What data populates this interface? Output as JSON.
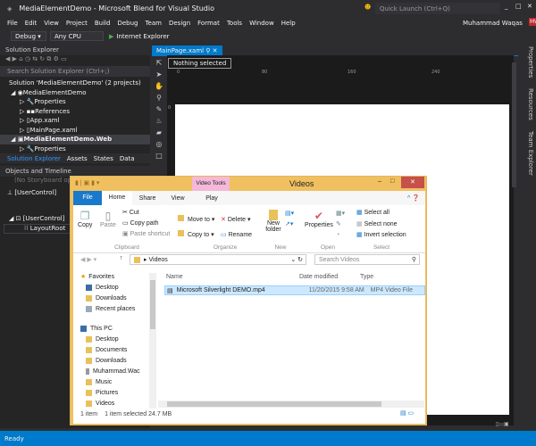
{
  "window": {
    "title": "MediaElementDemo - Microsoft Blend for Visual Studio",
    "quick_launch": "Quick Launch (Ctrl+Q)",
    "user": "Muhammad Waqas",
    "user_initials": "MW"
  },
  "menu": [
    "File",
    "Edit",
    "View",
    "Project",
    "Build",
    "Debug",
    "Team",
    "Design",
    "Format",
    "Tools",
    "Window",
    "Help"
  ],
  "toolbar": {
    "config": "Debug",
    "platform": "Any CPU",
    "run": "Internet Explorer"
  },
  "solution_explorer": {
    "title": "Solution Explorer",
    "search_placeholder": "Search Solution Explorer (Ctrl+;)",
    "items": [
      "Solution 'MediaElementDemo' (2 projects)",
      "MediaElementDemo",
      "Properties",
      "References",
      "App.xaml",
      "MainPage.xaml",
      "MediaElementDemo.Web",
      "Properties"
    ],
    "tabs": [
      "Solution Explorer",
      "Assets",
      "States",
      "Data"
    ]
  },
  "objects": {
    "title": "Objects and Timeline",
    "storyboard": "(No Storyboard open)",
    "root": "[UserControl]",
    "tree": [
      "[UserControl]",
      "LayoutRoot"
    ]
  },
  "document": {
    "tab": "MainPage.xaml",
    "selection": "Nothing selected",
    "ruler": [
      "0",
      "80",
      "160",
      "240"
    ],
    "ruler_left": "0"
  },
  "right_tabs": [
    "Properties",
    "Resources",
    "Team Explorer"
  ],
  "status": "Ready",
  "explorer": {
    "title": "Videos",
    "context_tab": "Video Tools",
    "context_subtab": "Play",
    "tabs": [
      "File",
      "Home",
      "Share",
      "View"
    ],
    "ribbon": {
      "copy": "Copy",
      "paste": "Paste",
      "cut": "Cut",
      "copy_path": "Copy path",
      "paste_shortcut": "Paste shortcut",
      "clipboard": "Clipboard",
      "move_to": "Move to",
      "copy_to": "Copy to",
      "delete": "Delete",
      "rename": "Rename",
      "organize": "Organize",
      "new_folder": "New folder",
      "new": "New",
      "properties": "Properties",
      "open": "Open",
      "select_all": "Select all",
      "select_none": "Select none",
      "invert": "Invert selection",
      "select": "Select"
    },
    "address": "Videos",
    "search_placeholder": "Search Videos",
    "nav": {
      "favorites": "Favorites",
      "fav_items": [
        "Desktop",
        "Downloads",
        "Recent places"
      ],
      "this_pc": "This PC",
      "pc_items": [
        "Desktop",
        "Documents",
        "Downloads",
        "Muhammad.Wac",
        "Music",
        "Pictures",
        "Videos"
      ]
    },
    "columns": [
      "Name",
      "Date modified",
      "Type"
    ],
    "files": [
      {
        "name": "Microsoft Silverlight DEMO.mp4",
        "date": "11/20/2015 9:58 AM",
        "type": "MP4 Video File"
      }
    ],
    "status": {
      "count": "1 item",
      "selected": "1 item selected",
      "size": "24.7 MB"
    }
  }
}
